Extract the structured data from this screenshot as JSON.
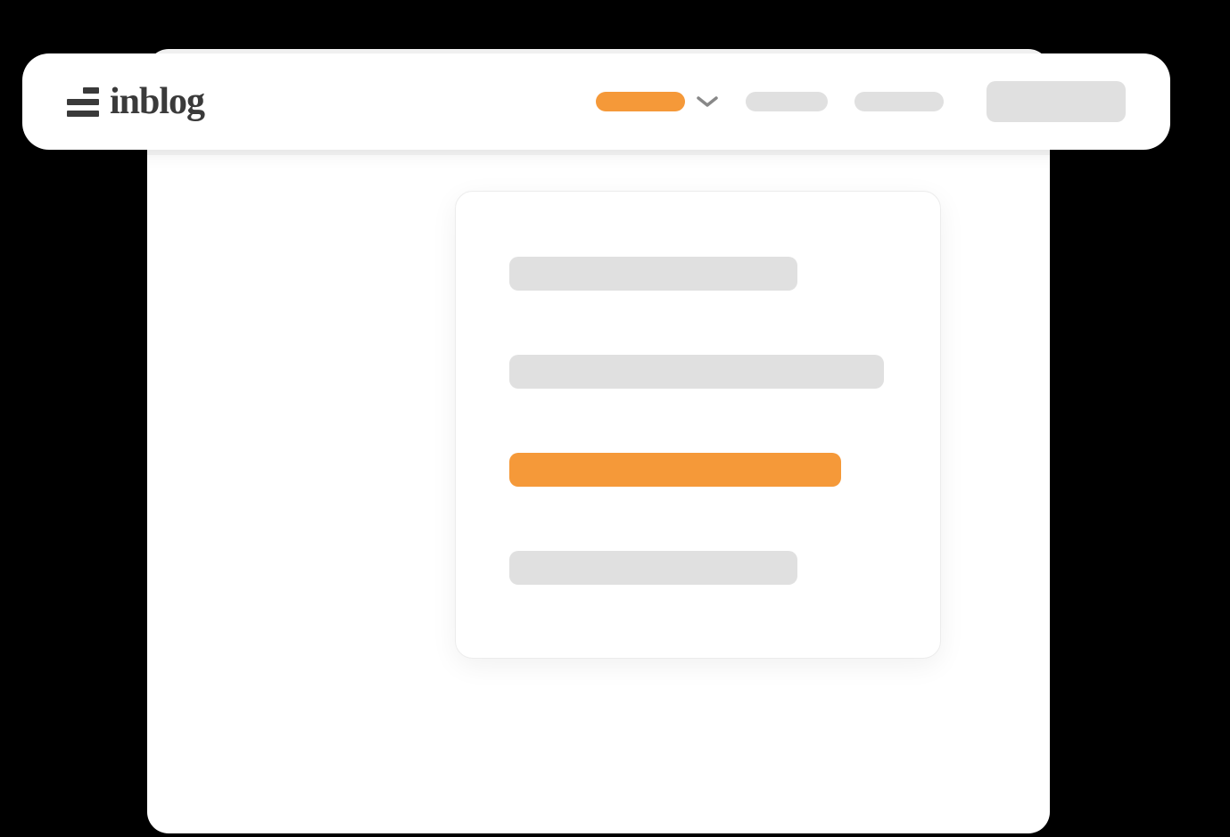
{
  "brand": {
    "name": "inblog",
    "icon": "inblog-logo-icon"
  },
  "header": {
    "nav_items": [
      {
        "label": "",
        "active": true,
        "has_dropdown": true
      },
      {
        "label": "",
        "active": false,
        "has_dropdown": false
      },
      {
        "label": "",
        "active": false,
        "has_dropdown": false
      }
    ],
    "cta_label": ""
  },
  "dropdown": {
    "items": [
      {
        "label": "",
        "active": false
      },
      {
        "label": "",
        "active": false
      },
      {
        "label": "",
        "active": true
      },
      {
        "label": "",
        "active": false
      }
    ]
  },
  "colors": {
    "accent": "#f59939",
    "neutral": "#e0e0e0",
    "text": "#3a3a3a"
  }
}
